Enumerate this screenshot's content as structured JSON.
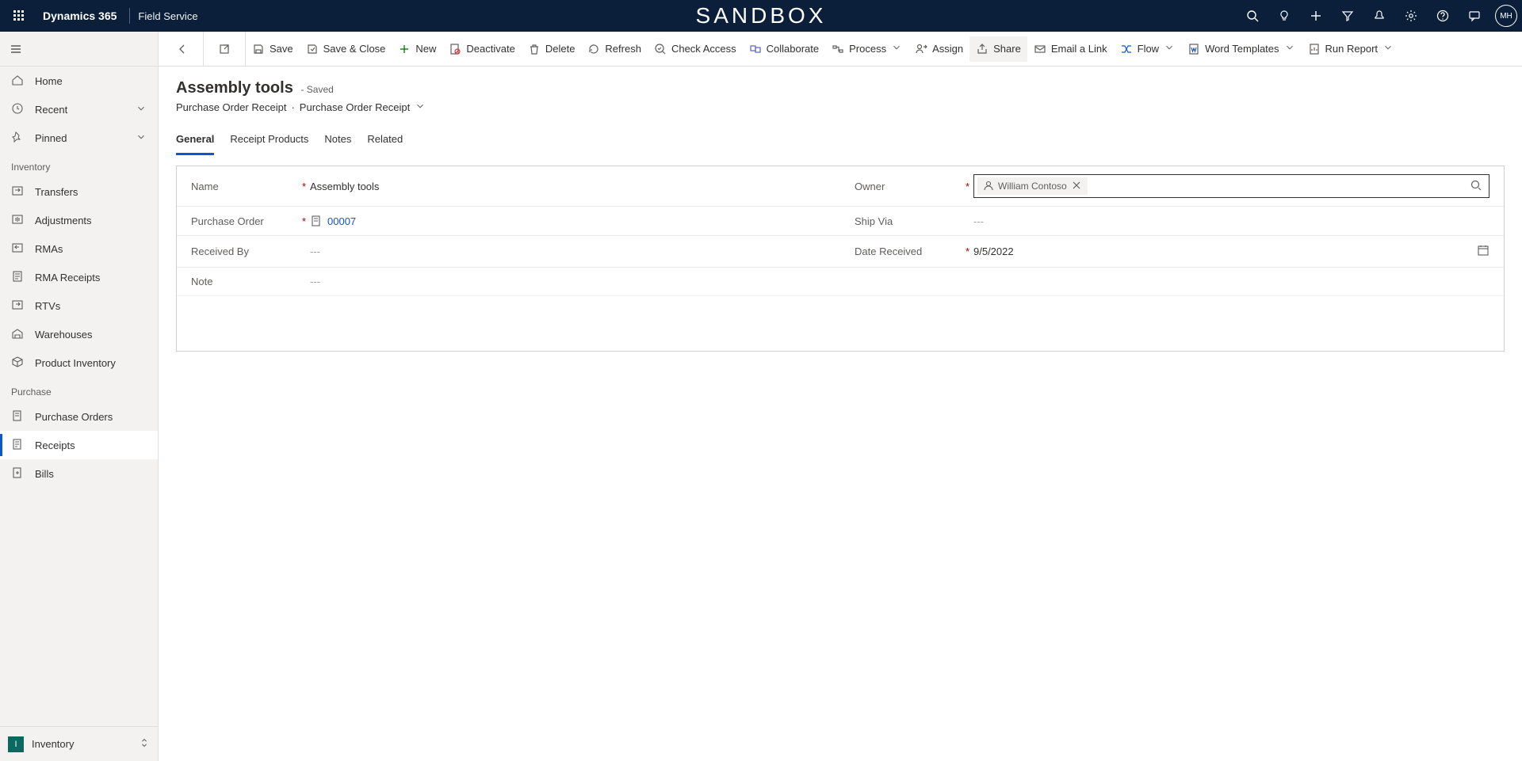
{
  "topbar": {
    "brand": "Dynamics 365",
    "app": "Field Service",
    "env_banner": "SANDBOX",
    "avatar_initials": "MH"
  },
  "sidebar": {
    "quick": {
      "home": "Home",
      "recent": "Recent",
      "pinned": "Pinned"
    },
    "section_inventory": "Inventory",
    "inventory": {
      "transfers": "Transfers",
      "adjustments": "Adjustments",
      "rmas": "RMAs",
      "rma_receipts": "RMA Receipts",
      "rtvs": "RTVs",
      "warehouses": "Warehouses",
      "product_inventory": "Product Inventory"
    },
    "section_purchase": "Purchase",
    "purchase": {
      "purchase_orders": "Purchase Orders",
      "receipts": "Receipts",
      "bills": "Bills"
    },
    "footer": {
      "icon_letter": "I",
      "label": "Inventory"
    }
  },
  "commandbar": {
    "save": "Save",
    "save_close": "Save & Close",
    "new": "New",
    "deactivate": "Deactivate",
    "delete": "Delete",
    "refresh": "Refresh",
    "check_access": "Check Access",
    "collaborate": "Collaborate",
    "process": "Process",
    "assign": "Assign",
    "share": "Share",
    "email_link": "Email a Link",
    "flow": "Flow",
    "word_templates": "Word Templates",
    "run_report": "Run Report"
  },
  "header": {
    "title": "Assembly tools",
    "status": "- Saved",
    "breadcrumb_entity": "Purchase Order Receipt",
    "breadcrumb_form": "Purchase Order Receipt"
  },
  "tabs": {
    "general": "General",
    "receipt_products": "Receipt Products",
    "notes": "Notes",
    "related": "Related"
  },
  "form": {
    "labels": {
      "name": "Name",
      "owner": "Owner",
      "purchase_order": "Purchase Order",
      "ship_via": "Ship Via",
      "received_by": "Received By",
      "date_received": "Date Received",
      "note": "Note"
    },
    "values": {
      "name": "Assembly tools",
      "owner": "William Contoso",
      "purchase_order": "00007",
      "ship_via": "---",
      "received_by": "---",
      "date_received": "9/5/2022",
      "note": "---"
    }
  }
}
